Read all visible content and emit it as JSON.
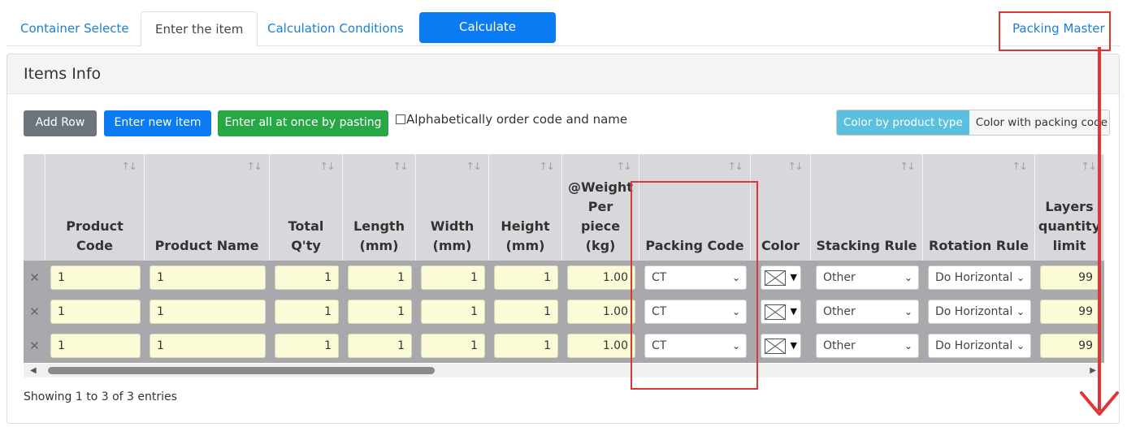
{
  "tabs": [
    {
      "label": "Container Selecte"
    },
    {
      "label": "Enter the item"
    },
    {
      "label": "Calculation Conditions"
    }
  ],
  "calculate_label": "Calculate",
  "packing_master_label": "Packing Master",
  "card": {
    "title": "Items Info"
  },
  "toolbar": {
    "add_row": "Add Row",
    "enter_new": "Enter new item",
    "paste": "Enter all at once by pasting",
    "alpha_order": "Alphabetically order code and name",
    "color_by_type": "Color by product type",
    "color_with_packing": "Color with packing code"
  },
  "sort_glyph": "↑↓",
  "headers": {
    "product_code": [
      "Product",
      "Code"
    ],
    "product_name": [
      "Product Name"
    ],
    "total_qty": [
      "Total",
      "Q'ty"
    ],
    "length": [
      "Length",
      "(mm)"
    ],
    "width": [
      "Width",
      "(mm)"
    ],
    "height": [
      "Height",
      "(mm)"
    ],
    "weight": [
      "@Weight",
      "Per",
      "piece",
      "(kg)"
    ],
    "packing_code": [
      "Packing Code"
    ],
    "color": [
      "Color"
    ],
    "stacking_rule": [
      "Stacking Rule"
    ],
    "rotation_rule": [
      "Rotation Rule"
    ],
    "layers_limit": [
      "Layers",
      "quantity",
      "limit"
    ]
  },
  "delete_glyph": "✕",
  "rows": [
    {
      "code": "1",
      "name": "1",
      "qty": "1",
      "length": "1",
      "width": "1",
      "height": "1",
      "weight": "1.00",
      "packing": "CT",
      "stacking": "Other",
      "rotation": "Do Horizontal",
      "layers": "99"
    },
    {
      "code": "1",
      "name": "1",
      "qty": "1",
      "length": "1",
      "width": "1",
      "height": "1",
      "weight": "1.00",
      "packing": "CT",
      "stacking": "Other",
      "rotation": "Do Horizontal",
      "layers": "99"
    },
    {
      "code": "1",
      "name": "1",
      "qty": "1",
      "length": "1",
      "width": "1",
      "height": "1",
      "weight": "1.00",
      "packing": "CT",
      "stacking": "Other",
      "rotation": "Do Horizontal",
      "layers": "99"
    }
  ],
  "footer": {
    "showing": "Showing 1 to 3 of 3 entries"
  }
}
